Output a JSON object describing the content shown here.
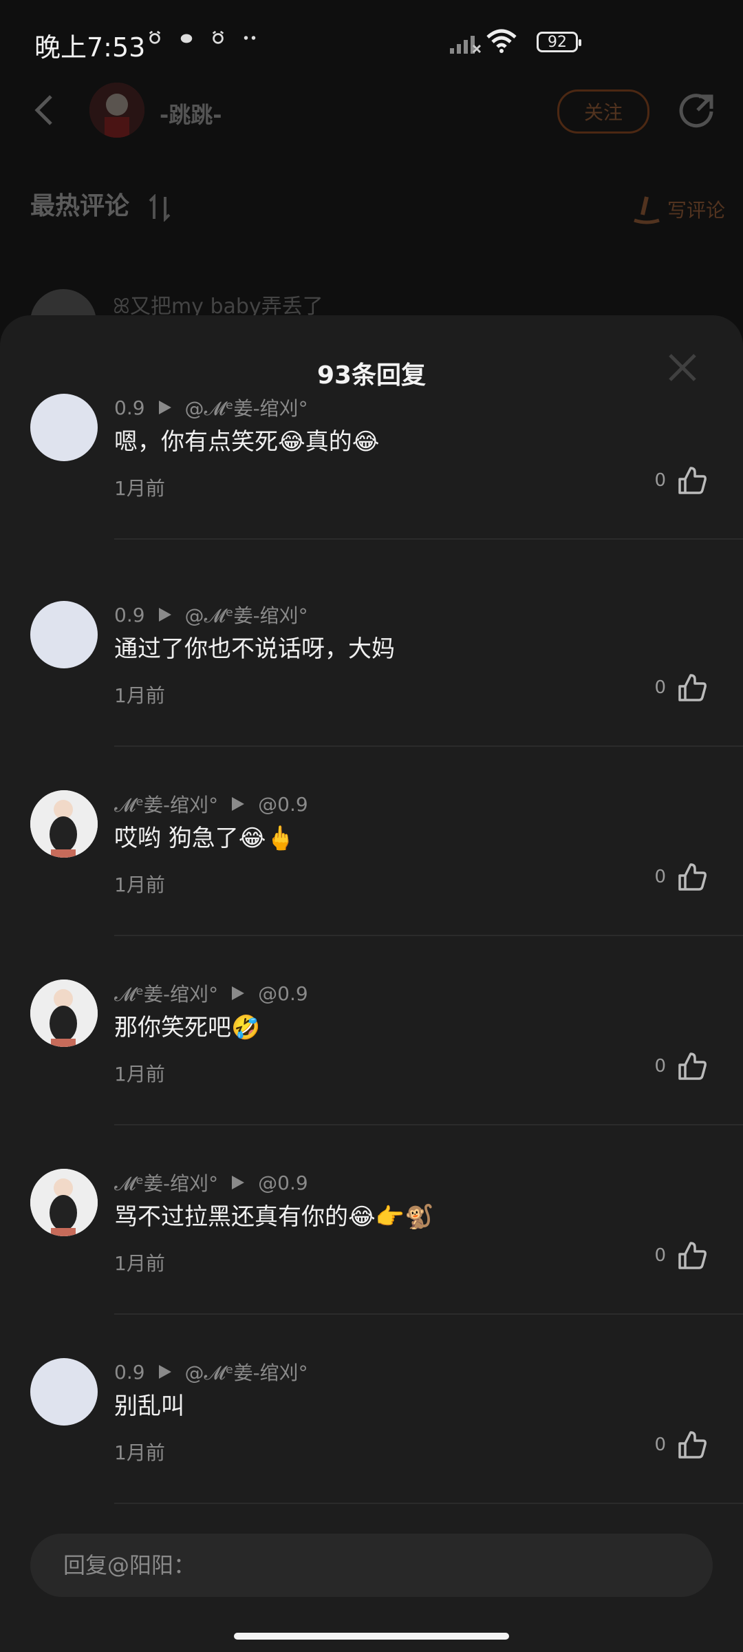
{
  "status_bar": {
    "time": "晚上7:53",
    "battery": "92",
    "left_icons": [
      "alarm-icon",
      "notification-icon",
      "alarm-icon",
      "more-dots-icon"
    ],
    "right_icons": [
      "signal-icon",
      "wifi-icon",
      "battery-icon"
    ]
  },
  "header": {
    "name": "-跳跳-",
    "follow_label": "关注",
    "icons": [
      "back-icon",
      "share-icon"
    ]
  },
  "comments_section": {
    "title": "最热评论",
    "write_label": "写评论",
    "background_comment": "ꕤ又把my baby弄丢了"
  },
  "sheet": {
    "title": "93条回复",
    "replies": [
      {
        "user": "0.9",
        "target": "@𝓜ᵉ姜-绾刈°",
        "content": "嗯，你有点笑死😂真的😂",
        "time": "1月前",
        "likes": "0"
      },
      {
        "user": "0.9",
        "target": "@𝓜ᵉ姜-绾刈°",
        "content": "通过了你也不说话呀，大妈",
        "time": "1月前",
        "likes": "0"
      },
      {
        "user": "𝓜ᵉ姜-绾刈°",
        "target": "@0.9",
        "content": "哎哟 狗急了😂🖕",
        "time": "1月前",
        "likes": "0"
      },
      {
        "user": "𝓜ᵉ姜-绾刈°",
        "target": "@0.9",
        "content": "那你笑死吧🤣",
        "time": "1月前",
        "likes": "0"
      },
      {
        "user": "𝓜ᵉ姜-绾刈°",
        "target": "@0.9",
        "content": "骂不过拉黑还真有你的😂👉🐒",
        "time": "1月前",
        "likes": "0"
      },
      {
        "user": "0.9",
        "target": "@𝓜ᵉ姜-绾刈°",
        "content": "别乱叫",
        "time": "1月前",
        "likes": "0"
      }
    ]
  },
  "reply_input": {
    "placeholder": "回复@阳阳："
  }
}
